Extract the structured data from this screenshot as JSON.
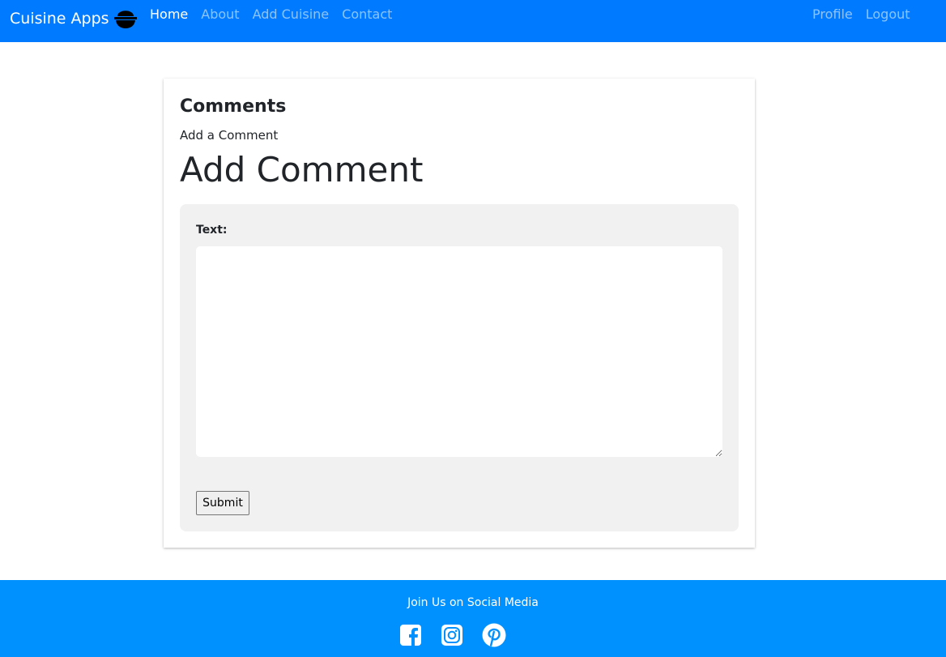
{
  "navbar": {
    "brand": "Cuisine Apps",
    "brand_icon": "bowl-icon",
    "links": [
      "Home",
      "About",
      "Add Cuisine",
      "Contact"
    ],
    "active": "Home",
    "right_links": [
      "Profile",
      "Logout"
    ],
    "bg_color": "#007bff"
  },
  "main": {
    "title": "Comments",
    "subtitle": "Add a Comment",
    "form_heading": "Add Comment",
    "form": {
      "text_label": "Text:",
      "text_value": "",
      "submit_label": "Submit"
    }
  },
  "footer": {
    "text": "Join Us on Social Media",
    "icons": [
      "facebook-icon",
      "instagram-icon",
      "pinterest-icon"
    ],
    "bg_color": "#0091ff"
  }
}
